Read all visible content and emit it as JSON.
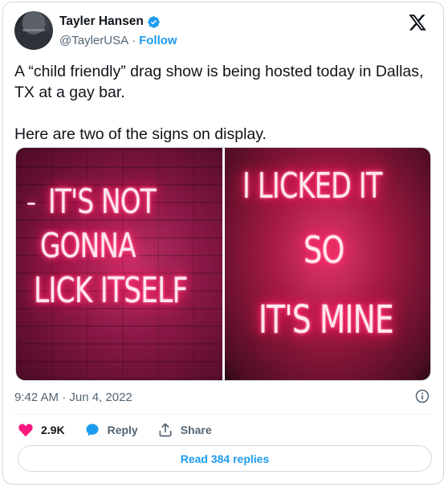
{
  "author": {
    "name": "Tayler Hansen",
    "handle": "@TaylerUSA",
    "separator": "·",
    "follow_label": "Follow"
  },
  "tweet": {
    "text": "A “child friendly” drag show is being hosted today in Dallas, TX at a gay bar.\n\nHere are two of the signs on display.",
    "timestamp": "9:42 AM · Jun 4, 2022"
  },
  "media": {
    "left_sign": [
      "IT'S NOT",
      "GONNA",
      "LICK ITSELF"
    ],
    "right_sign": [
      "I LICKED IT",
      "SO",
      "IT'S MINE"
    ]
  },
  "actions": {
    "likes": "2.9K",
    "reply_label": "Reply",
    "share_label": "Share"
  },
  "read_replies_label": "Read 384 replies",
  "colors": {
    "accent": "#1d9bf0",
    "like": "#f91880",
    "text_primary": "#0f1419",
    "text_secondary": "#536471",
    "border": "#cfd9de"
  },
  "icons": [
    "verified-badge-icon",
    "x-logo-icon",
    "info-icon",
    "heart-icon",
    "reply-bubble-icon",
    "share-icon"
  ]
}
